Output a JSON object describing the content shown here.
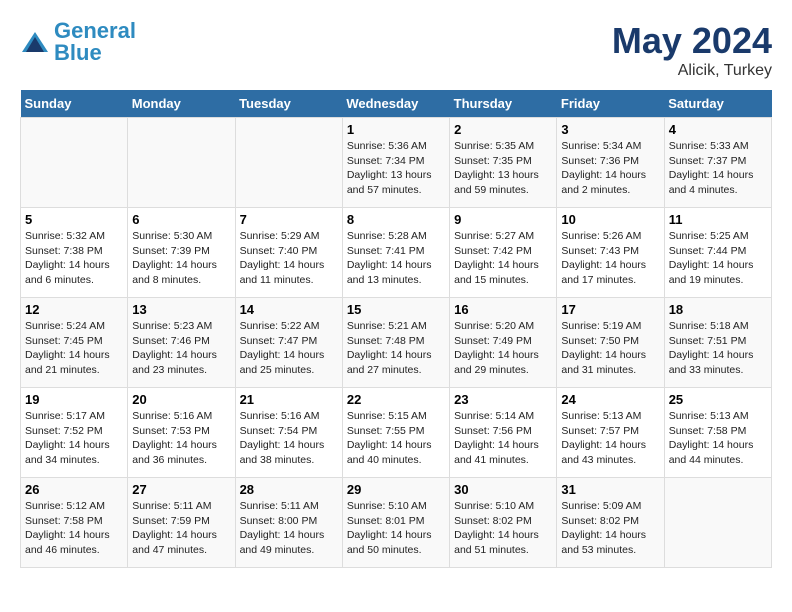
{
  "header": {
    "logo_line1": "General",
    "logo_line2": "Blue",
    "main_title": "May 2024",
    "subtitle": "Alicik, Turkey"
  },
  "columns": [
    "Sunday",
    "Monday",
    "Tuesday",
    "Wednesday",
    "Thursday",
    "Friday",
    "Saturday"
  ],
  "weeks": [
    [
      {
        "day": "",
        "info": ""
      },
      {
        "day": "",
        "info": ""
      },
      {
        "day": "",
        "info": ""
      },
      {
        "day": "1",
        "info": "Sunrise: 5:36 AM\nSunset: 7:34 PM\nDaylight: 13 hours\nand 57 minutes."
      },
      {
        "day": "2",
        "info": "Sunrise: 5:35 AM\nSunset: 7:35 PM\nDaylight: 13 hours\nand 59 minutes."
      },
      {
        "day": "3",
        "info": "Sunrise: 5:34 AM\nSunset: 7:36 PM\nDaylight: 14 hours\nand 2 minutes."
      },
      {
        "day": "4",
        "info": "Sunrise: 5:33 AM\nSunset: 7:37 PM\nDaylight: 14 hours\nand 4 minutes."
      }
    ],
    [
      {
        "day": "5",
        "info": "Sunrise: 5:32 AM\nSunset: 7:38 PM\nDaylight: 14 hours\nand 6 minutes."
      },
      {
        "day": "6",
        "info": "Sunrise: 5:30 AM\nSunset: 7:39 PM\nDaylight: 14 hours\nand 8 minutes."
      },
      {
        "day": "7",
        "info": "Sunrise: 5:29 AM\nSunset: 7:40 PM\nDaylight: 14 hours\nand 11 minutes."
      },
      {
        "day": "8",
        "info": "Sunrise: 5:28 AM\nSunset: 7:41 PM\nDaylight: 14 hours\nand 13 minutes."
      },
      {
        "day": "9",
        "info": "Sunrise: 5:27 AM\nSunset: 7:42 PM\nDaylight: 14 hours\nand 15 minutes."
      },
      {
        "day": "10",
        "info": "Sunrise: 5:26 AM\nSunset: 7:43 PM\nDaylight: 14 hours\nand 17 minutes."
      },
      {
        "day": "11",
        "info": "Sunrise: 5:25 AM\nSunset: 7:44 PM\nDaylight: 14 hours\nand 19 minutes."
      }
    ],
    [
      {
        "day": "12",
        "info": "Sunrise: 5:24 AM\nSunset: 7:45 PM\nDaylight: 14 hours\nand 21 minutes."
      },
      {
        "day": "13",
        "info": "Sunrise: 5:23 AM\nSunset: 7:46 PM\nDaylight: 14 hours\nand 23 minutes."
      },
      {
        "day": "14",
        "info": "Sunrise: 5:22 AM\nSunset: 7:47 PM\nDaylight: 14 hours\nand 25 minutes."
      },
      {
        "day": "15",
        "info": "Sunrise: 5:21 AM\nSunset: 7:48 PM\nDaylight: 14 hours\nand 27 minutes."
      },
      {
        "day": "16",
        "info": "Sunrise: 5:20 AM\nSunset: 7:49 PM\nDaylight: 14 hours\nand 29 minutes."
      },
      {
        "day": "17",
        "info": "Sunrise: 5:19 AM\nSunset: 7:50 PM\nDaylight: 14 hours\nand 31 minutes."
      },
      {
        "day": "18",
        "info": "Sunrise: 5:18 AM\nSunset: 7:51 PM\nDaylight: 14 hours\nand 33 minutes."
      }
    ],
    [
      {
        "day": "19",
        "info": "Sunrise: 5:17 AM\nSunset: 7:52 PM\nDaylight: 14 hours\nand 34 minutes."
      },
      {
        "day": "20",
        "info": "Sunrise: 5:16 AM\nSunset: 7:53 PM\nDaylight: 14 hours\nand 36 minutes."
      },
      {
        "day": "21",
        "info": "Sunrise: 5:16 AM\nSunset: 7:54 PM\nDaylight: 14 hours\nand 38 minutes."
      },
      {
        "day": "22",
        "info": "Sunrise: 5:15 AM\nSunset: 7:55 PM\nDaylight: 14 hours\nand 40 minutes."
      },
      {
        "day": "23",
        "info": "Sunrise: 5:14 AM\nSunset: 7:56 PM\nDaylight: 14 hours\nand 41 minutes."
      },
      {
        "day": "24",
        "info": "Sunrise: 5:13 AM\nSunset: 7:57 PM\nDaylight: 14 hours\nand 43 minutes."
      },
      {
        "day": "25",
        "info": "Sunrise: 5:13 AM\nSunset: 7:58 PM\nDaylight: 14 hours\nand 44 minutes."
      }
    ],
    [
      {
        "day": "26",
        "info": "Sunrise: 5:12 AM\nSunset: 7:58 PM\nDaylight: 14 hours\nand 46 minutes."
      },
      {
        "day": "27",
        "info": "Sunrise: 5:11 AM\nSunset: 7:59 PM\nDaylight: 14 hours\nand 47 minutes."
      },
      {
        "day": "28",
        "info": "Sunrise: 5:11 AM\nSunset: 8:00 PM\nDaylight: 14 hours\nand 49 minutes."
      },
      {
        "day": "29",
        "info": "Sunrise: 5:10 AM\nSunset: 8:01 PM\nDaylight: 14 hours\nand 50 minutes."
      },
      {
        "day": "30",
        "info": "Sunrise: 5:10 AM\nSunset: 8:02 PM\nDaylight: 14 hours\nand 51 minutes."
      },
      {
        "day": "31",
        "info": "Sunrise: 5:09 AM\nSunset: 8:02 PM\nDaylight: 14 hours\nand 53 minutes."
      },
      {
        "day": "",
        "info": ""
      }
    ]
  ]
}
